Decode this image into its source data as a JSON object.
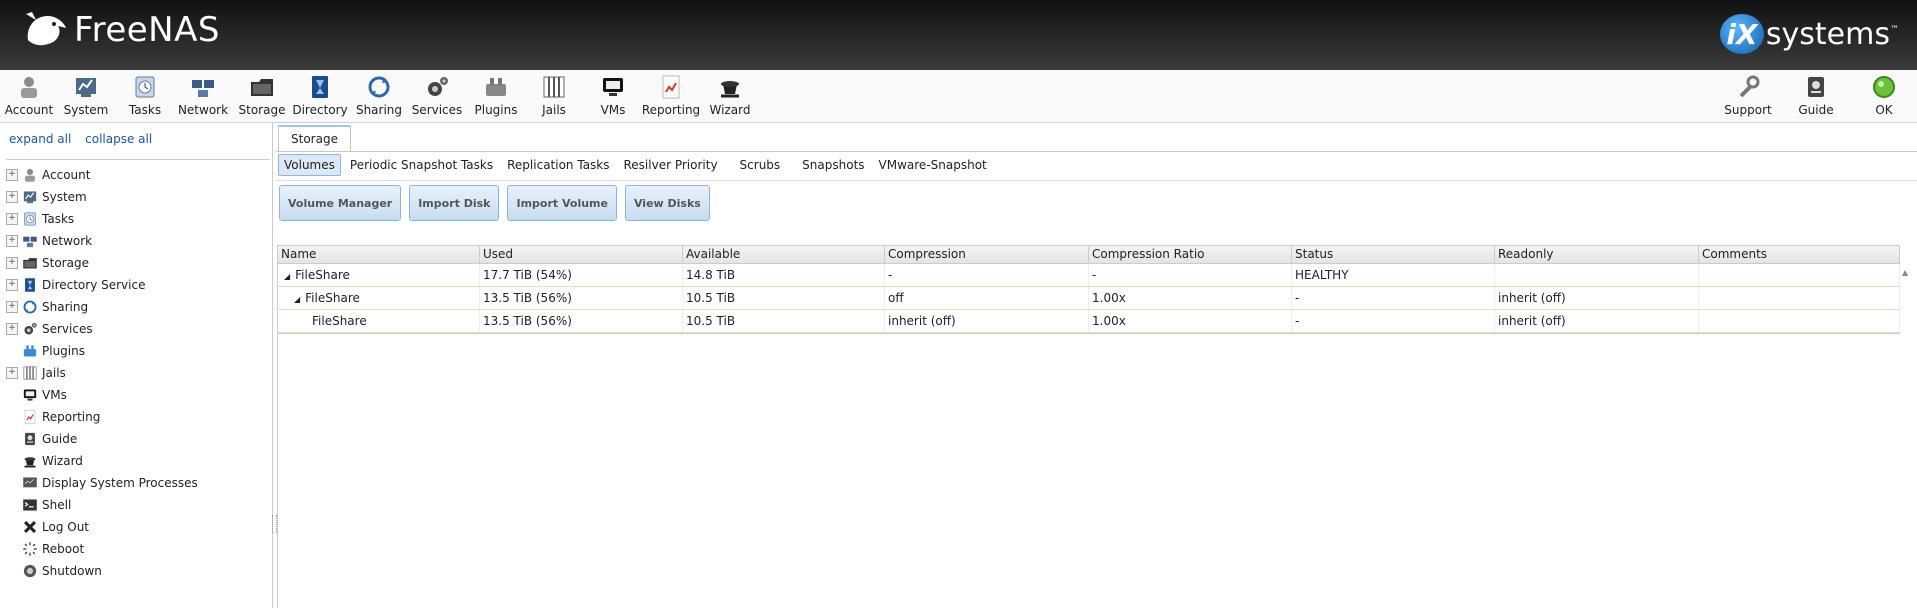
{
  "header": {
    "brand": "FreeNAS",
    "brand_tm": "™",
    "vendor_badge": "iX",
    "vendor_text": "systems",
    "vendor_tm": "™"
  },
  "toolbar": {
    "left": [
      {
        "label": "Account",
        "icon": "account-icon"
      },
      {
        "label": "System",
        "icon": "system-icon"
      },
      {
        "label": "Tasks",
        "icon": "tasks-icon"
      },
      {
        "label": "Network",
        "icon": "network-icon"
      },
      {
        "label": "Storage",
        "icon": "storage-icon"
      },
      {
        "label": "Directory",
        "icon": "directory-icon"
      },
      {
        "label": "Sharing",
        "icon": "sharing-icon"
      },
      {
        "label": "Services",
        "icon": "services-icon"
      },
      {
        "label": "Plugins",
        "icon": "plugins-icon"
      },
      {
        "label": "Jails",
        "icon": "jails-icon"
      },
      {
        "label": "VMs",
        "icon": "vms-icon"
      },
      {
        "label": "Reporting",
        "icon": "reporting-icon"
      },
      {
        "label": "Wizard",
        "icon": "wizard-icon"
      }
    ],
    "right": [
      {
        "label": "Support",
        "icon": "support-icon"
      },
      {
        "label": "Guide",
        "icon": "guide-icon"
      },
      {
        "label": "OK",
        "icon": "alert-ok-icon"
      }
    ]
  },
  "sidebar": {
    "expand_all": "expand all",
    "collapse_all": "collapse all",
    "items": [
      {
        "label": "Account",
        "expandable": true
      },
      {
        "label": "System",
        "expandable": true
      },
      {
        "label": "Tasks",
        "expandable": true
      },
      {
        "label": "Network",
        "expandable": true
      },
      {
        "label": "Storage",
        "expandable": true
      },
      {
        "label": "Directory Service",
        "expandable": true
      },
      {
        "label": "Sharing",
        "expandable": true
      },
      {
        "label": "Services",
        "expandable": true
      },
      {
        "label": "Plugins",
        "expandable": false
      },
      {
        "label": "Jails",
        "expandable": true
      },
      {
        "label": "VMs",
        "expandable": false
      },
      {
        "label": "Reporting",
        "expandable": false
      },
      {
        "label": "Guide",
        "expandable": false
      },
      {
        "label": "Wizard",
        "expandable": false
      },
      {
        "label": "Display System Processes",
        "expandable": false
      },
      {
        "label": "Shell",
        "expandable": false
      },
      {
        "label": "Log Out",
        "expandable": false
      },
      {
        "label": "Reboot",
        "expandable": false
      },
      {
        "label": "Shutdown",
        "expandable": false
      }
    ]
  },
  "main": {
    "tab": "Storage",
    "subtabs": [
      "Volumes",
      "Periodic Snapshot Tasks",
      "Replication Tasks",
      "Resilver Priority",
      "Scrubs",
      "Snapshots",
      "VMware-Snapshot"
    ],
    "active_subtab": "Volumes",
    "actions": [
      "Volume Manager",
      "Import Disk",
      "Import Volume",
      "View Disks"
    ],
    "columns": [
      "Name",
      "Used",
      "Available",
      "Compression",
      "Compression Ratio",
      "Status",
      "Readonly",
      "Comments"
    ],
    "rows": [
      {
        "indent": 0,
        "expander": "◢",
        "cells": [
          "FileShare",
          "17.7 TiB (54%)",
          "14.8 TiB",
          "-",
          "-",
          "HEALTHY",
          "",
          ""
        ]
      },
      {
        "indent": 1,
        "expander": "◢",
        "cells": [
          "FileShare",
          "13.5 TiB (56%)",
          "10.5 TiB",
          "off",
          "1.00x",
          "-",
          "inherit (off)",
          ""
        ]
      },
      {
        "indent": 2,
        "expander": "",
        "cells": [
          "FileShare",
          "13.5 TiB (56%)",
          "10.5 TiB",
          "inherit (off)",
          "1.00x",
          "-",
          "inherit (off)",
          ""
        ]
      }
    ],
    "scroll_up_glyph": "▲"
  }
}
